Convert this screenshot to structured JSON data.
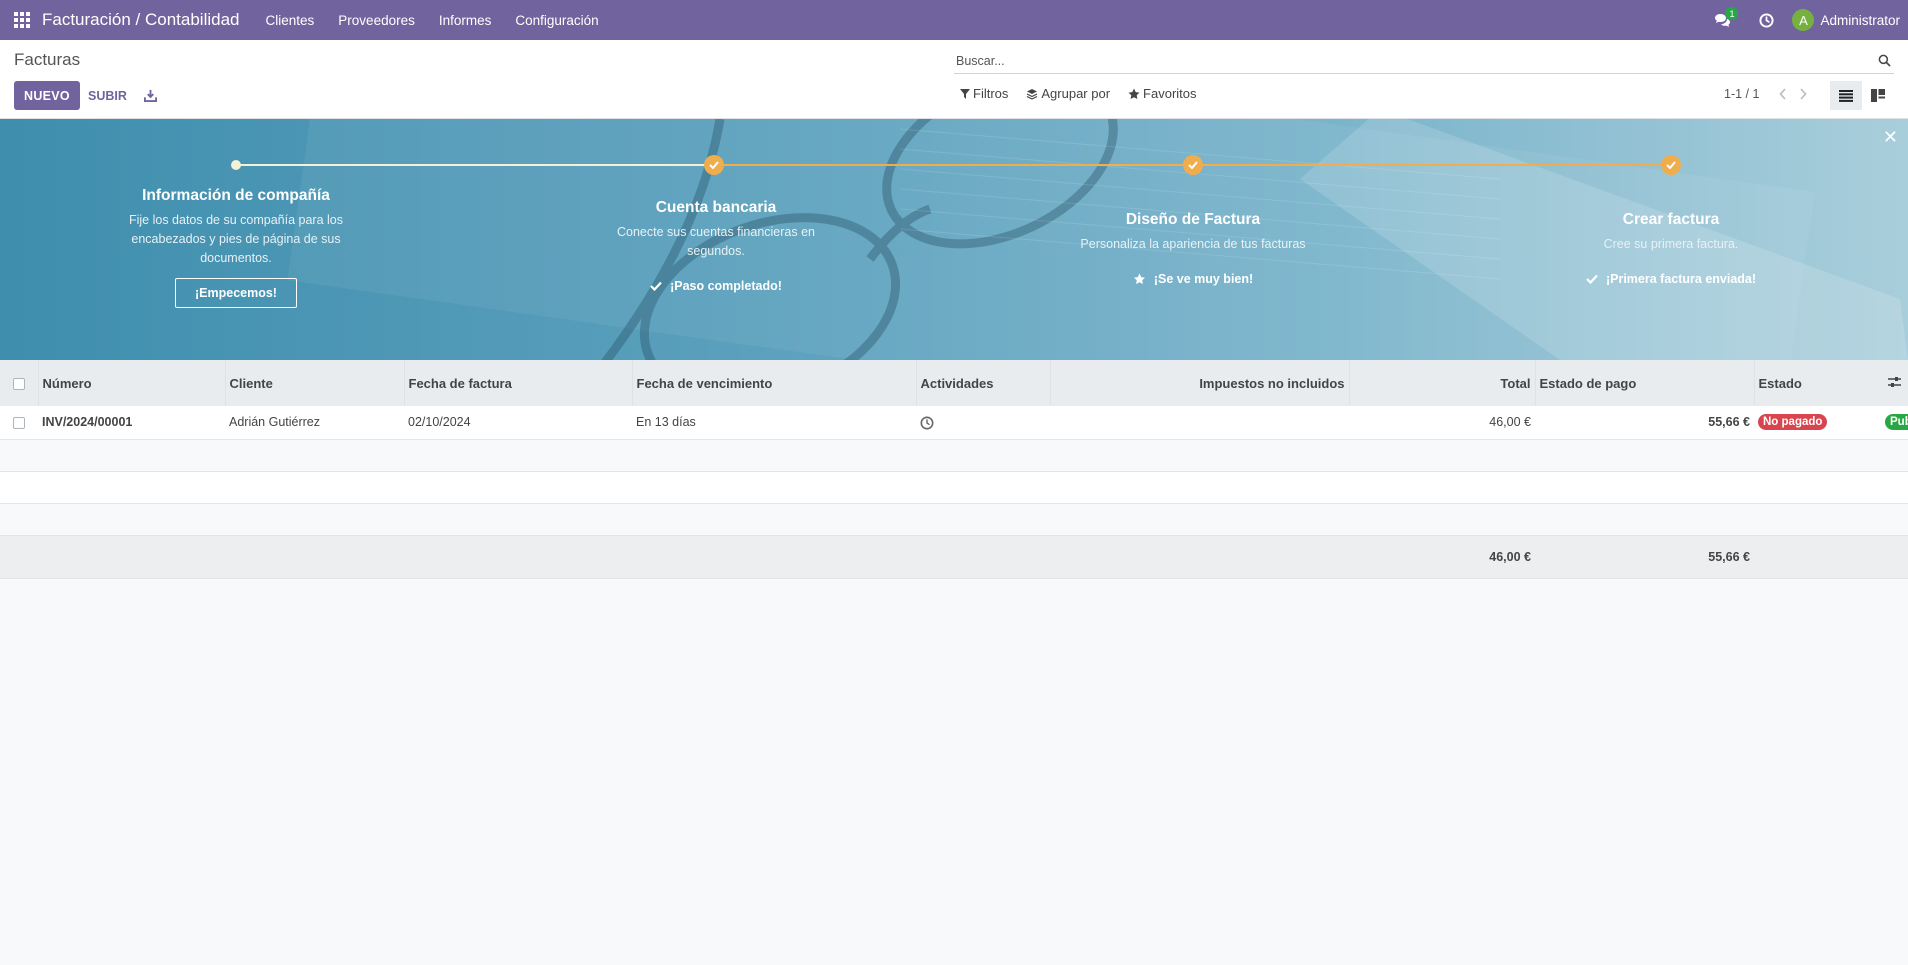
{
  "navbar": {
    "brand": "Facturación / Contabilidad",
    "menu": [
      "Clientes",
      "Proveedores",
      "Informes",
      "Configuración"
    ],
    "messages_count": "1",
    "user_initial": "A",
    "user_name": "Administrator",
    "colors": {
      "bar": "#71639e",
      "avatar": "#76b041",
      "badge": "#28a745"
    }
  },
  "control_panel": {
    "breadcrumb": "Facturas",
    "new_label": "NUEVO",
    "upload_label": "SUBIR",
    "search_placeholder": "Buscar...",
    "filters_label": "Filtros",
    "groupby_label": "Agrupar por",
    "favorites_label": "Favoritos",
    "pager": "1-1 / 1"
  },
  "onboarding": {
    "steps": [
      {
        "title": "Información de compañía",
        "desc": "Fije los datos de su compañía para los encabezados y pies de página de sus documentos.",
        "button": "¡Empecemos!"
      },
      {
        "title": "Cuenta bancaria",
        "desc": "Conecte sus cuentas financieras en segundos.",
        "done": "¡Paso completado!"
      },
      {
        "title": "Diseño de Factura",
        "desc": "Personaliza la apariencia de tus facturas",
        "done": "¡Se ve muy bien!"
      },
      {
        "title": "Crear factura",
        "desc": "Cree su primera factura.",
        "done": "¡Primera factura enviada!"
      }
    ],
    "colors": {
      "done_dot": "#f0ad4e",
      "line_done": "#f0ad4e"
    }
  },
  "table": {
    "columns": [
      "Número",
      "Cliente",
      "Fecha de factura",
      "Fecha de vencimiento",
      "Actividades",
      "Impuestos no incluidos",
      "Total",
      "Estado de pago",
      "Estado"
    ],
    "rows": [
      {
        "number": "INV/2024/00001",
        "client": "Adrián Gutiérrez",
        "invoice_date": "02/10/2024",
        "due": "En 13 días",
        "activity_icon": "clock-icon",
        "untaxed": "46,00 €",
        "total": "55,66 €",
        "payment_state": "No pagado",
        "state": "Publicado"
      }
    ],
    "totals": {
      "untaxed": "46,00 €",
      "total": "55,66 €"
    },
    "colors": {
      "danger": "#d9454f",
      "success": "#28a745"
    }
  }
}
